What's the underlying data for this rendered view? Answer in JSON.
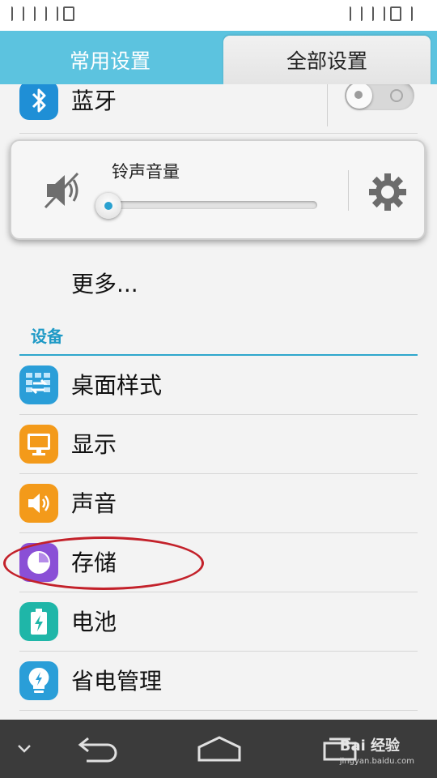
{
  "tabs": [
    {
      "label": "常用设置",
      "active": false
    },
    {
      "label": "全部设置",
      "active": true
    }
  ],
  "bluetooth": {
    "label": "蓝牙",
    "toggle_on": false
  },
  "volume_popup": {
    "title": "铃声音量",
    "level": 0.0
  },
  "more": {
    "label": "更多..."
  },
  "section": {
    "label": "设备"
  },
  "items": [
    {
      "label": "桌面样式",
      "icon": "home-style-icon",
      "color": "#2a9ed8"
    },
    {
      "label": "显示",
      "icon": "display-icon",
      "color": "#f39a1a"
    },
    {
      "label": "声音",
      "icon": "sound-icon",
      "color": "#f39a1a"
    },
    {
      "label": "存储",
      "icon": "storage-icon",
      "color": "#8a4fd6"
    },
    {
      "label": "电池",
      "icon": "battery-icon",
      "color": "#1fb6a8"
    },
    {
      "label": "省电管理",
      "icon": "power-saving-icon",
      "color": "#2a9ed8"
    }
  ],
  "watermark": {
    "brand": "Bai 经验",
    "url": "jingyan.baidu.com"
  },
  "colors": {
    "accent": "#5cc3df",
    "highlight": "#c3212a",
    "navbar": "#3b3b3b"
  }
}
